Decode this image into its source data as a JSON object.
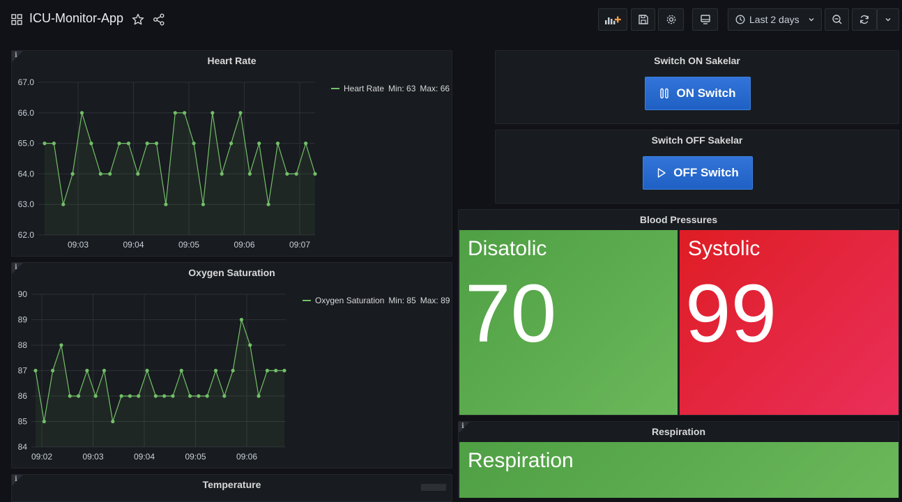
{
  "header": {
    "title": "ICU-Monitor-App",
    "time_range": "Last 2 days"
  },
  "colors": {
    "series": "#73bf69",
    "blue": "#1f60c4",
    "green_tile": "#56a64b",
    "red_tile": "#e02f44"
  },
  "panels": {
    "heart_rate": {
      "title": "Heart Rate"
    },
    "oxygen": {
      "title": "Oxygen Saturation"
    },
    "temperature": {
      "title": "Temperature"
    },
    "switch_on": {
      "title": "Switch ON Sakelar",
      "button": "ON Switch"
    },
    "switch_off": {
      "title": "Switch OFF Sakelar",
      "button": "OFF Switch"
    },
    "blood_pressure": {
      "title": "Blood Pressures",
      "diastolic_label": "Disatolic",
      "diastolic_value": "70",
      "systolic_label": "Systolic",
      "systolic_value": "99"
    },
    "respiration": {
      "title": "Respiration",
      "label": "Respiration"
    }
  },
  "chart_data": [
    {
      "type": "line",
      "title": "Heart Rate",
      "series": [
        {
          "name": "Heart Rate",
          "values": [
            65,
            65,
            63,
            64,
            66,
            65,
            64,
            64,
            65,
            65,
            64,
            65,
            65,
            63,
            66,
            66,
            65,
            63,
            66,
            64,
            65,
            66,
            64,
            65,
            63,
            65,
            64,
            64,
            65,
            64
          ]
        }
      ],
      "legend": {
        "name": "Heart Rate",
        "min": "Min: 63",
        "max": "Max: 66"
      },
      "xticks": [
        "09:03",
        "09:04",
        "09:05",
        "09:06",
        "09:07"
      ],
      "yticks": [
        "67.0",
        "66.0",
        "65.0",
        "64.0",
        "63.0",
        "62.0"
      ],
      "ylim": [
        62,
        67
      ],
      "grid": true,
      "legend_placement": "right"
    },
    {
      "type": "line",
      "title": "Oxygen Saturation",
      "series": [
        {
          "name": "Oxygen Saturation",
          "values": [
            87,
            85,
            87,
            88,
            86,
            86,
            87,
            86,
            87,
            85,
            86,
            86,
            86,
            87,
            86,
            86,
            86,
            87,
            86,
            86,
            86,
            87,
            86,
            87,
            89,
            88,
            86,
            87,
            87,
            87
          ]
        }
      ],
      "legend": {
        "name": "Oxygen Saturation",
        "min": "Min: 85",
        "max": "Max: 89"
      },
      "xticks": [
        "09:02",
        "09:03",
        "09:04",
        "09:05",
        "09:06"
      ],
      "yticks": [
        "90",
        "89",
        "88",
        "87",
        "86",
        "85",
        "84"
      ],
      "ylim": [
        84,
        90
      ],
      "grid": true,
      "legend_placement": "right"
    }
  ]
}
